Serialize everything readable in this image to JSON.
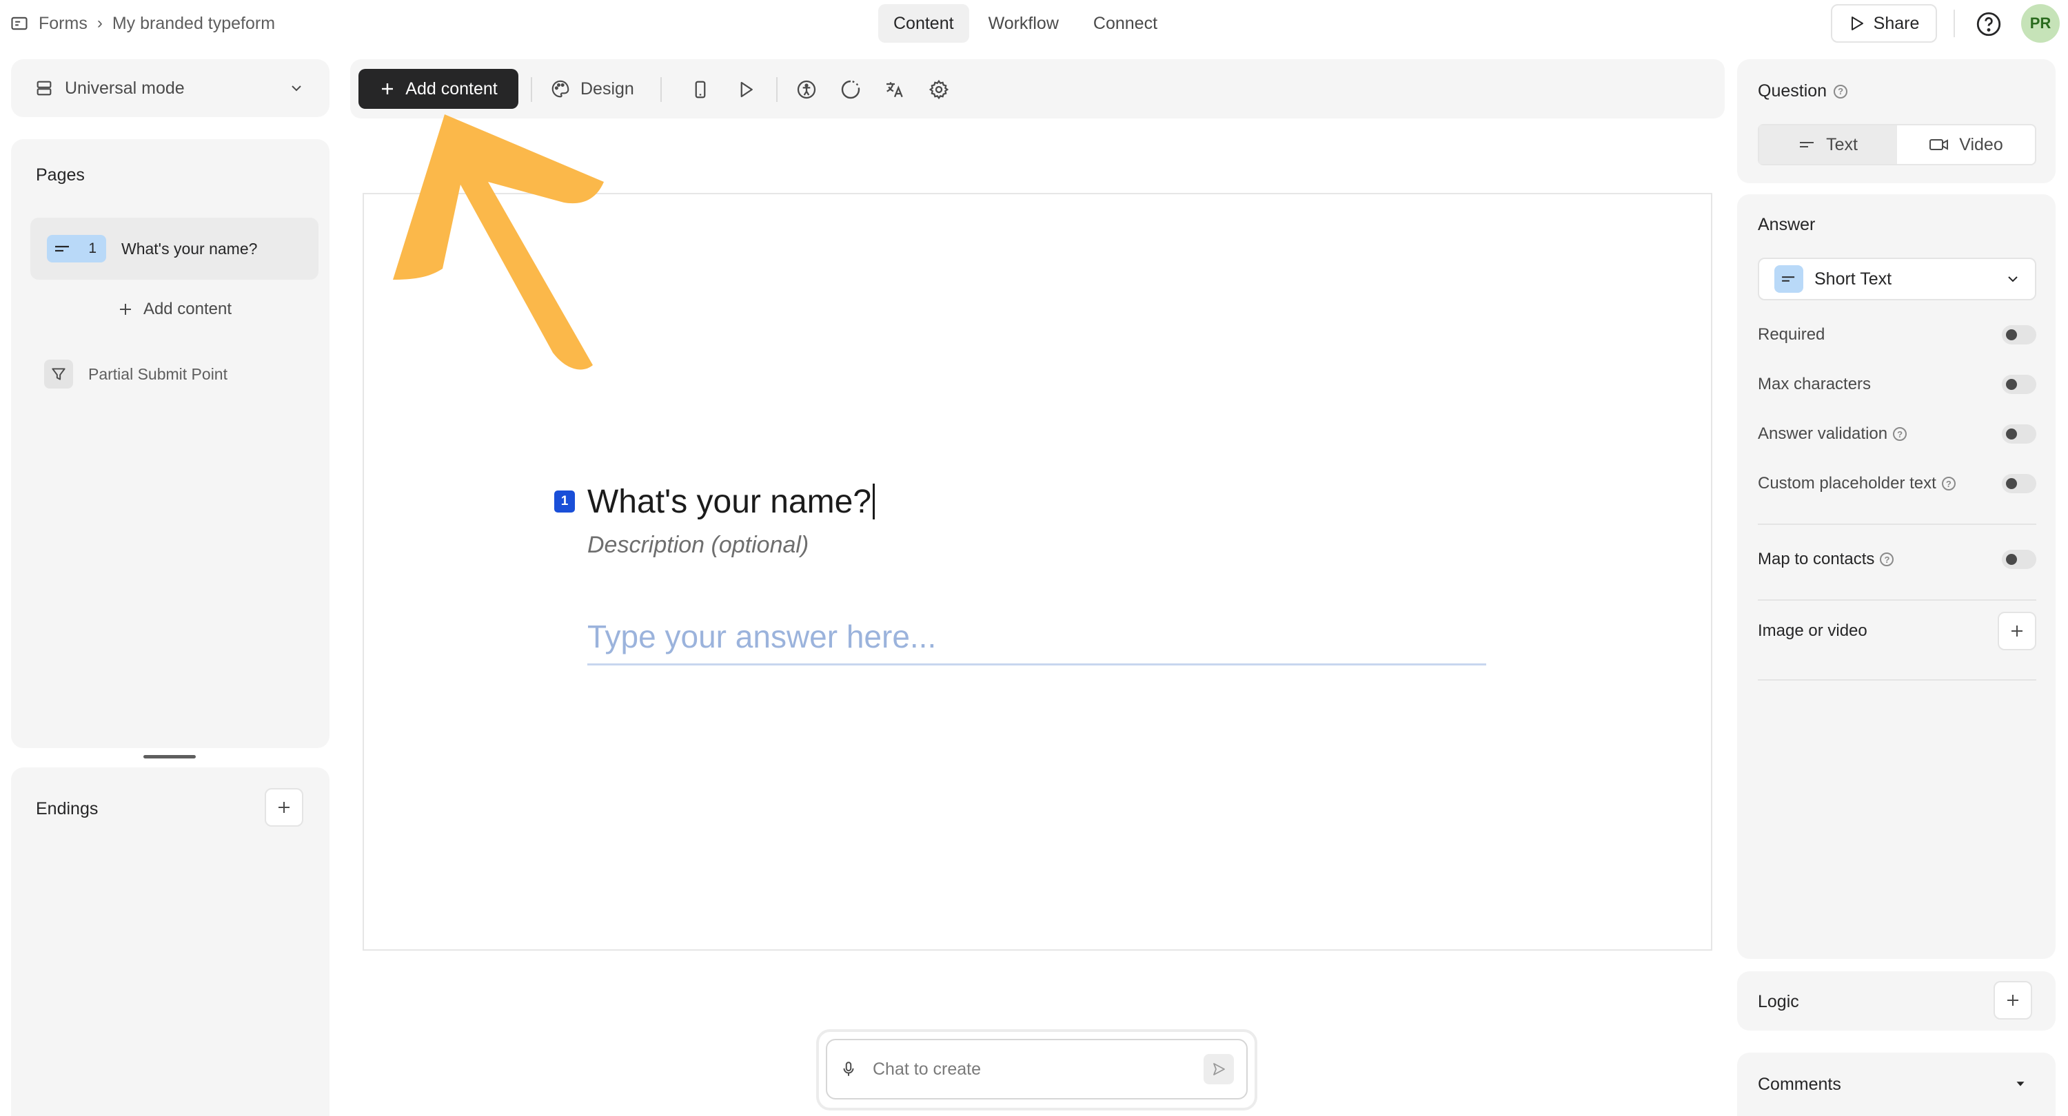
{
  "breadcrumb": {
    "root": "Forms",
    "current": "My branded typeform"
  },
  "nav_tabs": [
    {
      "label": "Content",
      "active": true
    },
    {
      "label": "Workflow",
      "active": false
    },
    {
      "label": "Connect",
      "active": false
    }
  ],
  "header": {
    "share_label": "Share",
    "avatar_initials": "PR"
  },
  "mode": {
    "label": "Universal mode"
  },
  "pages": {
    "title": "Pages",
    "items": [
      {
        "number": "1",
        "label": "What's your name?"
      }
    ],
    "add_label": "Add content",
    "partial_submit_label": "Partial Submit Point"
  },
  "endings": {
    "title": "Endings"
  },
  "toolbar": {
    "add_content_label": "Add content",
    "design_label": "Design",
    "icons": [
      "mobile-preview-icon",
      "play-icon",
      "accessibility-icon",
      "loading-icon",
      "translate-icon",
      "settings-icon"
    ]
  },
  "question": {
    "number": "1",
    "title": "What's your name?",
    "description": "Description (optional)",
    "answer_placeholder": "Type your answer here..."
  },
  "chat": {
    "placeholder": "Chat to create"
  },
  "panel": {
    "question_label": "Question",
    "question_types": [
      {
        "label": "Text",
        "active": true
      },
      {
        "label": "Video",
        "active": false
      }
    ],
    "answer_label": "Answer",
    "answer_type": "Short Text",
    "options": [
      {
        "label": "Required",
        "enabled": false,
        "info": false
      },
      {
        "label": "Max characters",
        "enabled": false,
        "info": false
      },
      {
        "label": "Answer validation",
        "enabled": false,
        "info": true
      },
      {
        "label": "Custom placeholder text",
        "enabled": false,
        "info": true
      }
    ],
    "map_contacts_label": "Map to contacts",
    "image_video_label": "Image or video",
    "logic_label": "Logic",
    "comments_label": "Comments"
  },
  "colors": {
    "accent_dark": "#262627",
    "question_number_bg": "#1a4fd8",
    "chip_blue": "#b9d9f8",
    "annotation_arrow": "#fbb84a",
    "avatar_bg": "#c6e3b8"
  }
}
